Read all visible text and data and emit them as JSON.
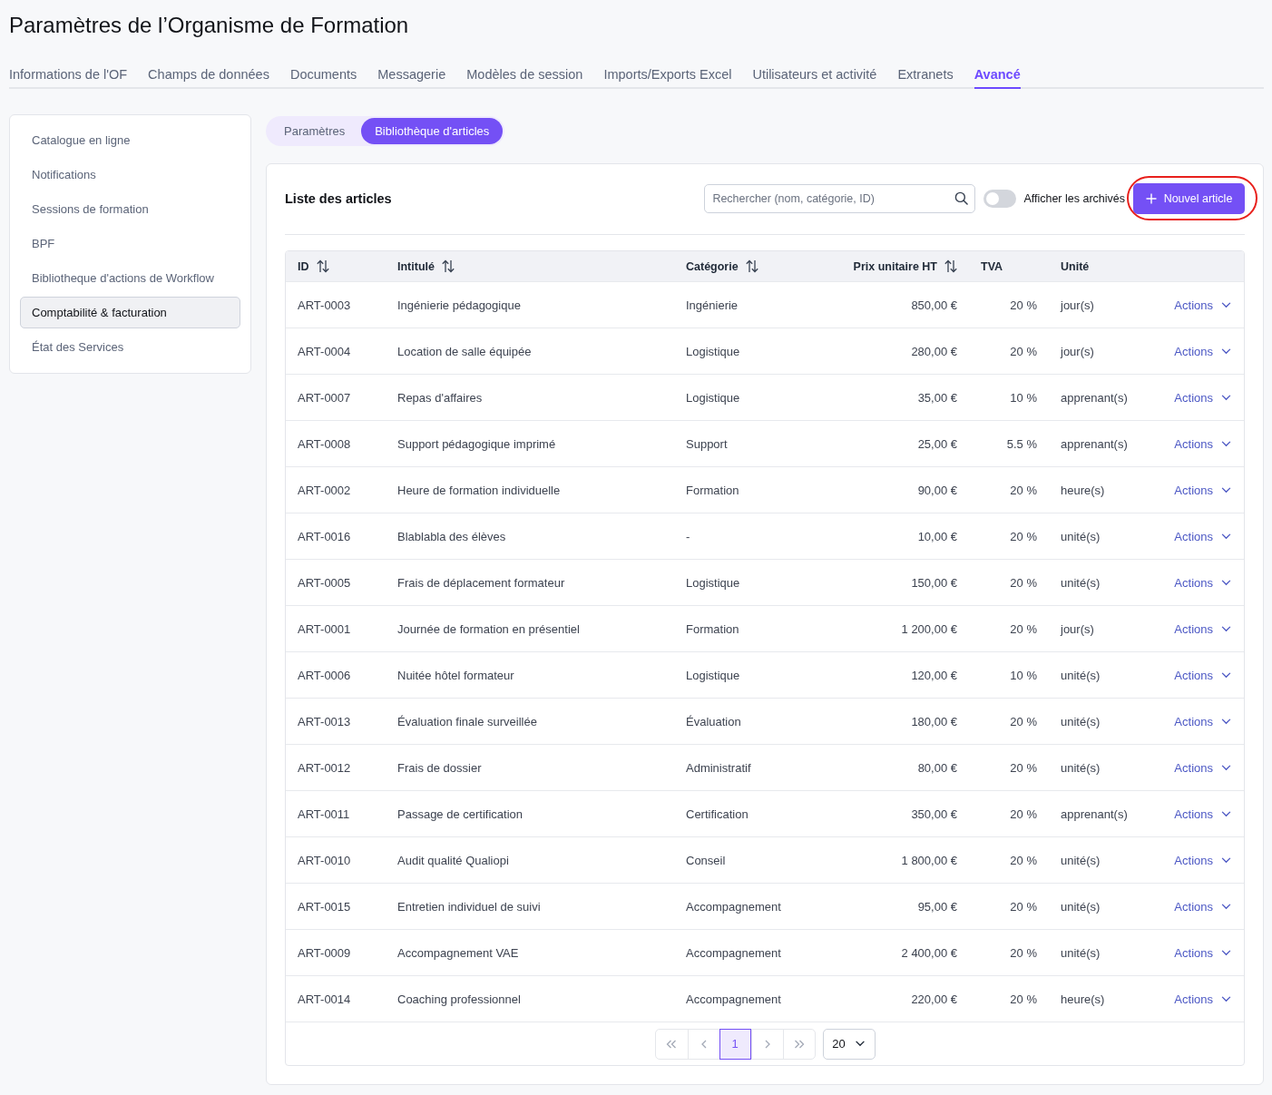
{
  "page": {
    "title": "Paramètres de l’Organisme de Formation"
  },
  "tabs": [
    {
      "label": "Informations de l'OF",
      "selected": false
    },
    {
      "label": "Champs de données",
      "selected": false
    },
    {
      "label": "Documents",
      "selected": false
    },
    {
      "label": "Messagerie",
      "selected": false
    },
    {
      "label": "Modèles de session",
      "selected": false
    },
    {
      "label": "Imports/Exports Excel",
      "selected": false
    },
    {
      "label": "Utilisateurs et activité",
      "selected": false
    },
    {
      "label": "Extranets",
      "selected": false
    },
    {
      "label": "Avancé",
      "selected": true
    }
  ],
  "sidebar": {
    "items": [
      {
        "label": "Catalogue en ligne",
        "selected": false
      },
      {
        "label": "Notifications",
        "selected": false
      },
      {
        "label": "Sessions de formation",
        "selected": false
      },
      {
        "label": "BPF",
        "selected": false
      },
      {
        "label": "Bibliotheque d'actions de Workflow",
        "selected": false
      },
      {
        "label": "Comptabilité & facturation",
        "selected": true
      },
      {
        "label": "État des Services",
        "selected": false
      }
    ]
  },
  "view_switch": [
    {
      "label": "Paramètres",
      "selected": false
    },
    {
      "label": "Bibliothèque d'articles",
      "selected": true
    }
  ],
  "articles_panel": {
    "title": "Liste des articles",
    "search": {
      "placeholder": "Rechercher (nom, catégorie, ID)"
    },
    "archive_toggle": {
      "label": "Afficher les archivés",
      "on": false
    },
    "new_button": {
      "label": "Nouvel article",
      "highlighted": true
    }
  },
  "table": {
    "columns": [
      {
        "label": "ID",
        "sortable": true
      },
      {
        "label": "Intitulé",
        "sortable": true
      },
      {
        "label": "Catégorie",
        "sortable": true
      },
      {
        "label": "Prix unitaire HT",
        "sortable": true
      },
      {
        "label": "TVA",
        "sortable": false
      },
      {
        "label": "Unité",
        "sortable": false
      }
    ],
    "rows": [
      {
        "id": "ART-0003",
        "title": "Ingénierie pédagogique",
        "category": "Ingénierie",
        "unit_price": "850,00 €",
        "vat": "20 %",
        "unit": "jour(s)",
        "actions": "Actions"
      },
      {
        "id": "ART-0004",
        "title": "Location de salle équipée",
        "category": "Logistique",
        "unit_price": "280,00 €",
        "vat": "20 %",
        "unit": "jour(s)",
        "actions": "Actions"
      },
      {
        "id": "ART-0007",
        "title": "Repas d'affaires",
        "category": "Logistique",
        "unit_price": "35,00 €",
        "vat": "10 %",
        "unit": "apprenant(s)",
        "actions": "Actions"
      },
      {
        "id": "ART-0008",
        "title": "Support pédagogique imprimé",
        "category": "Support",
        "unit_price": "25,00 €",
        "vat": "5.5 %",
        "unit": "apprenant(s)",
        "actions": "Actions"
      },
      {
        "id": "ART-0002",
        "title": "Heure de formation individuelle",
        "category": "Formation",
        "unit_price": "90,00 €",
        "vat": "20 %",
        "unit": "heure(s)",
        "actions": "Actions"
      },
      {
        "id": "ART-0016",
        "title": "Blablabla des élèves",
        "category": "-",
        "unit_price": "10,00 €",
        "vat": "20 %",
        "unit": "unité(s)",
        "actions": "Actions"
      },
      {
        "id": "ART-0005",
        "title": "Frais de déplacement formateur",
        "category": "Logistique",
        "unit_price": "150,00 €",
        "vat": "20 %",
        "unit": "unité(s)",
        "actions": "Actions"
      },
      {
        "id": "ART-0001",
        "title": "Journée de formation en présentiel",
        "category": "Formation",
        "unit_price": "1 200,00 €",
        "vat": "20 %",
        "unit": "jour(s)",
        "actions": "Actions"
      },
      {
        "id": "ART-0006",
        "title": "Nuitée hôtel formateur",
        "category": "Logistique",
        "unit_price": "120,00 €",
        "vat": "10 %",
        "unit": "unité(s)",
        "actions": "Actions"
      },
      {
        "id": "ART-0013",
        "title": "Évaluation finale surveillée",
        "category": "Évaluation",
        "unit_price": "180,00 €",
        "vat": "20 %",
        "unit": "unité(s)",
        "actions": "Actions"
      },
      {
        "id": "ART-0012",
        "title": "Frais de dossier",
        "category": "Administratif",
        "unit_price": "80,00 €",
        "vat": "20 %",
        "unit": "unité(s)",
        "actions": "Actions"
      },
      {
        "id": "ART-0011",
        "title": "Passage de certification",
        "category": "Certification",
        "unit_price": "350,00 €",
        "vat": "20 %",
        "unit": "apprenant(s)",
        "actions": "Actions"
      },
      {
        "id": "ART-0010",
        "title": "Audit qualité Qualiopi",
        "category": "Conseil",
        "unit_price": "1 800,00 €",
        "vat": "20 %",
        "unit": "unité(s)",
        "actions": "Actions"
      },
      {
        "id": "ART-0015",
        "title": "Entretien individuel de suivi",
        "category": "Accompagnement",
        "unit_price": "95,00 €",
        "vat": "20 %",
        "unit": "unité(s)",
        "actions": "Actions"
      },
      {
        "id": "ART-0009",
        "title": "Accompagnement VAE",
        "category": "Accompagnement",
        "unit_price": "2 400,00 €",
        "vat": "20 %",
        "unit": "unité(s)",
        "actions": "Actions"
      },
      {
        "id": "ART-0014",
        "title": "Coaching professionnel",
        "category": "Accompagnement",
        "unit_price": "220,00 €",
        "vat": "20 %",
        "unit": "heure(s)",
        "actions": "Actions"
      }
    ]
  },
  "pagination": {
    "first": {
      "disabled": true
    },
    "previous": {
      "disabled": true
    },
    "pages": [
      {
        "label": "1",
        "selected": true
      }
    ],
    "next": {
      "disabled": true
    },
    "last": {
      "disabled": true
    },
    "page_size": "20"
  }
}
